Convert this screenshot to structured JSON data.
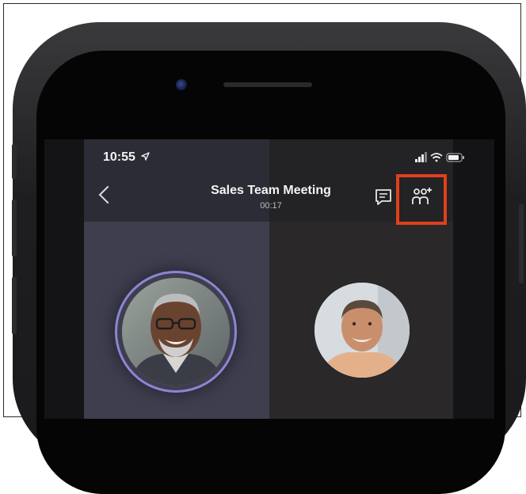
{
  "status_bar": {
    "time": "10:55"
  },
  "call": {
    "title": "Sales Team Meeting",
    "timer": "00:17"
  },
  "icons": {
    "back": "chevron-left-icon",
    "location": "location-arrow-icon",
    "chat": "chat-icon",
    "participants": "add-participants-icon",
    "signal": "signal-icon",
    "wifi": "wifi-icon",
    "battery": "battery-icon"
  },
  "participants": [
    {
      "avatar": "participant-1-avatar",
      "speaking": true
    },
    {
      "avatar": "participant-2-avatar",
      "speaking": false
    }
  ],
  "colors": {
    "highlight": "#e0401c",
    "speaking_ring": "#8a86d4"
  }
}
